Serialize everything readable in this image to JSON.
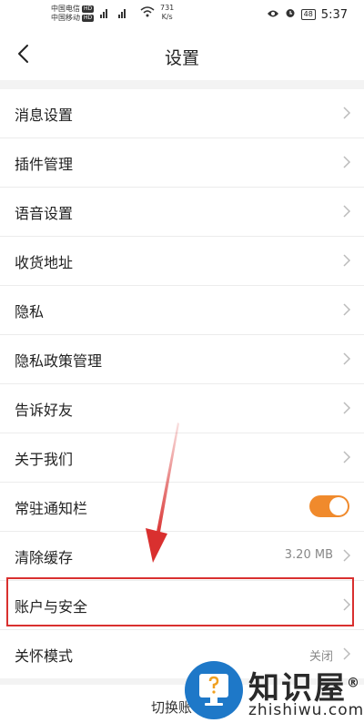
{
  "status_bar": {
    "carrier_1": "中国电信",
    "carrier_2": "中国移动",
    "hd_badge": "HD",
    "signal_text": "⁴ᴳ ⁴ᴳ",
    "net_speed_value": "731",
    "net_speed_unit": "K/s",
    "battery": "48",
    "time": "5:37"
  },
  "header": {
    "title": "设置"
  },
  "settings": {
    "items": [
      {
        "label": "消息设置"
      },
      {
        "label": "插件管理"
      },
      {
        "label": "语音设置"
      },
      {
        "label": "收货地址"
      },
      {
        "label": "隐私"
      },
      {
        "label": "隐私政策管理"
      },
      {
        "label": "告诉好友"
      },
      {
        "label": "关于我们"
      },
      {
        "label": "常驻通知栏",
        "toggle": true
      },
      {
        "label": "清除缓存",
        "value": "3.20 MB"
      },
      {
        "label": "账户与安全"
      },
      {
        "label": "关怀模式",
        "value": "关闭"
      }
    ]
  },
  "footer": {
    "switch_account": "切换账"
  },
  "watermark": {
    "text": "知识屋",
    "registered": "®",
    "domain": "zhishiwu.com"
  },
  "colors": {
    "toggle_on": "#f08a2c",
    "highlight": "#d9302f",
    "watermark_blue": "#1e78c8"
  }
}
